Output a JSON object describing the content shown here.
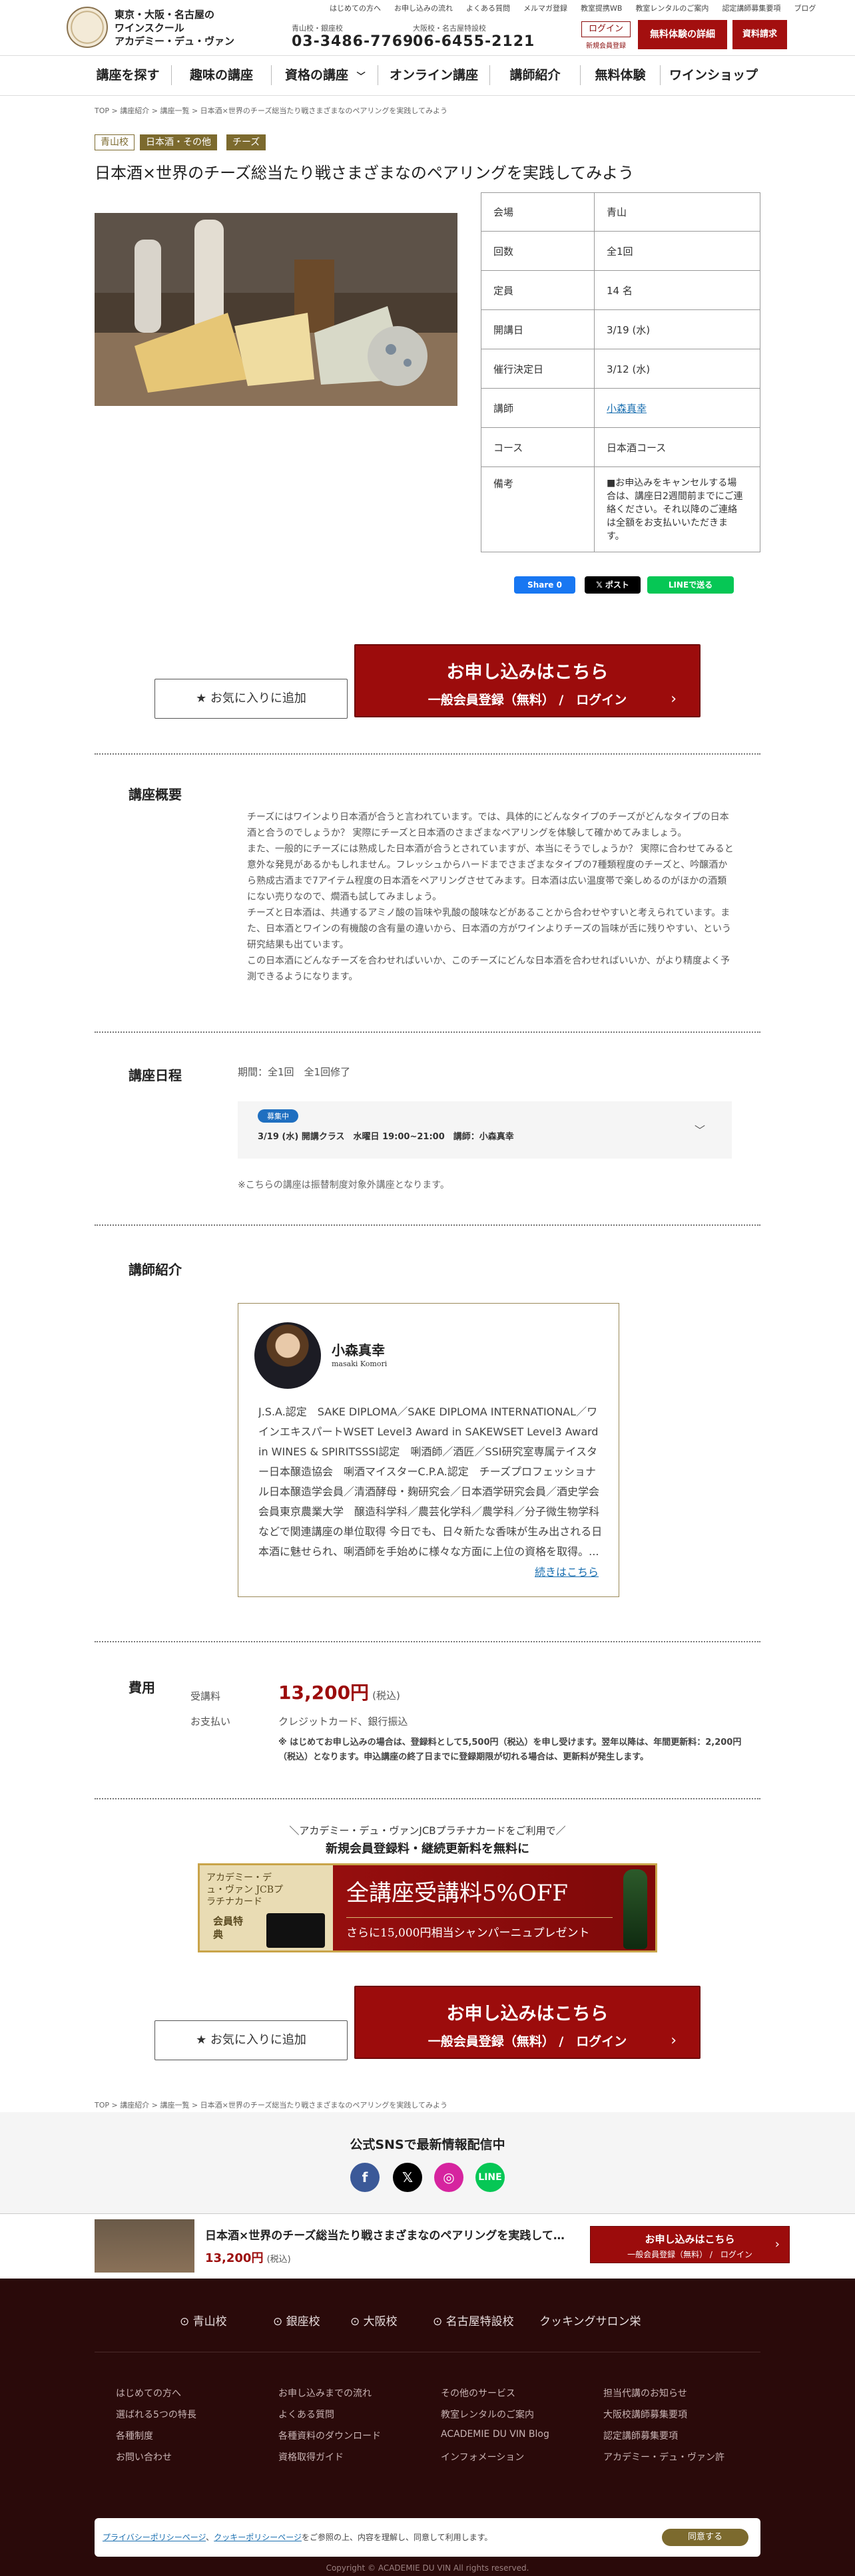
{
  "header": {
    "logo_text": [
      "東京・大阪・名古屋の",
      "ワインスクール",
      "アカデミー・デュ・ヴァン"
    ],
    "top_links": [
      "はじめての方へ",
      "お申し込みの流れ",
      "よくある質問",
      "メルマガ登録",
      "教室提携WB",
      "教室レンタルのご案内",
      "認定講師募集要項",
      "ブログ"
    ],
    "phone_tokyo_label": "青山校・銀座校",
    "phone_tokyo": "03-3486-7769",
    "phone_osaka_label": "大阪校・名古屋特設校",
    "phone_osaka": "06-6455-2121",
    "login": "ログイン",
    "new_register": "新規会員登録",
    "trial_button": "無料体験の詳細",
    "doc_button": "資料請求"
  },
  "nav": [
    "講座を探す",
    "趣味の講座",
    "資格の講座",
    "オンライン講座",
    "講師紹介",
    "無料体験",
    "ワインショップ"
  ],
  "breadcrumb": [
    "TOP",
    "講座紹介",
    "講座一覧",
    "日本酒×世界のチーズ総当たり戦さまざまなのペアリングを実践してみよう"
  ],
  "tags": [
    "青山校",
    "日本酒・その他",
    "チーズ"
  ],
  "course": {
    "title": "日本酒×世界のチーズ総当たり戦さまざまなのペアリングを実践してみよう"
  },
  "info": [
    {
      "label": "会場",
      "value": "青山"
    },
    {
      "label": "回数",
      "value": "全1回"
    },
    {
      "label": "定員",
      "value": "14 名"
    },
    {
      "label": "開講日",
      "value": "3/19 (水)"
    },
    {
      "label": "催行決定日",
      "value": "3/12 (水)"
    },
    {
      "label": "講師",
      "value": "小森真幸"
    },
    {
      "label": "コース",
      "value": "日本酒コース"
    },
    {
      "label": "備考",
      "value": "■お申込みをキャンセルする場合は、講座日2週間前までにご連絡ください。それ以降のご連絡は全額をお支払いいただきます。"
    }
  ],
  "share": {
    "facebook": "Share 0",
    "x": "ポスト",
    "line": "LINEで送る"
  },
  "cta": {
    "favorite": "★ お気に入りに追加",
    "apply_line1": "お申し込みはこちら",
    "apply_line2": "一般会員登録（無料） /　ログイン",
    "arrow": "›"
  },
  "overview": {
    "title": "講座概要",
    "paragraphs": [
      "チーズにはワインより日本酒が合うと言われています。では、具体的にどんなタイプのチーズがどんなタイプの日本酒と合うのでしょうか？ 実際にチーズと日本酒のさまざまなペアリングを体験して確かめてみましょう。",
      "また、一般的にチーズには熟成した日本酒が合うとされていますが、本当にそうでしょうか？ 実際に合わせてみると意外な発見があるかもしれません。フレッシュからハードまでさまざまなタイプの7種類程度のチーズと、吟醸酒から熟成古酒まで7アイテム程度の日本酒をペアリングさせてみます。日本酒は広い温度帯で楽しめるのがほかの酒類にない売りなので、燗酒も試してみましょう。",
      "チーズと日本酒は、共通するアミノ酸の旨味や乳酸の酸味などがあることから合わせやすいと考えられています。また、日本酒とワインの有機酸の含有量の違いから、日本酒の方がワインよりチーズの旨味が舌に残りやすい、という研究結果も出ています。",
      "この日本酒にどんなチーズを合わせればいいか、このチーズにどんな日本酒を合わせればいいか、がより精度よく予測できるようになります。"
    ]
  },
  "schedule": {
    "title": "講座日程",
    "period": "期間：全1回　全1回修了",
    "badge": "募集中",
    "class_line": "3/19 (水) 開講クラス　水曜日 19:00~21:00　講師：小森真幸",
    "note": "※こちらの講座は振替制度対象外講座となります。"
  },
  "instructor": {
    "section_title": "講師紹介",
    "name": "小森真幸",
    "name_en": "masaki Komori",
    "bio": "J.S.A.認定　SAKE DIPLOMA／SAKE DIPLOMA INTERNATIONAL／ワインエキスパートWSET Level3 Award in SAKEWSET Level3 Award in WINES & SPIRITSSSI認定　唎酒師／酒匠／SSI研究室専属テイスター日本醸造協会　唎酒マイスターC.P.A.認定　チーズプロフェッショナル日本醸造学会員／清酒酵母・麹研究会／日本酒学研究会員／酒史学会会員東京農業大学　醸造科学科／農芸化学科／農学科／分子微生物学科などで関連講座の単位取得 今日でも、日々新たな香味が生み出される日本酒に魅せられ、唎酒師を手始めに様々な方面に上位の資格を取得。...",
    "more": "続きはこちら"
  },
  "fees": {
    "title": "費用",
    "fee_label": "受講料",
    "fee_value": "13,200円",
    "fee_tax": "(税込)",
    "pay_label": "お支払い",
    "pay_value": "クレジットカード、銀行振込",
    "note": "※ はじめてお申し込みの場合は、登録料として5,500円（税込）を申し受けます。翌年以降は、年間更新料：2,200円（税込）となります。申込講座の終了日までに登録期限が切れる場合は、更新料が発生します。"
  },
  "promo": {
    "line1": "＼アカデミー・デュ・ヴァンJCBプラチナカードをご利用で／",
    "line2": "新規会員登録料・継続更新料を無料に",
    "card_name": "アカデミー・デュ・ヴァン JCBプラチナカード",
    "member": "会員特典",
    "headline": "全講座受講料5%OFF",
    "sub": "さらに15,000円相当シャンパーニュプレゼント"
  },
  "sns": {
    "title": "公式SNSで最新情報配信中",
    "icons": [
      "facebook-icon",
      "x-icon",
      "instagram-icon",
      "line-icon"
    ]
  },
  "sticky": {
    "title": "日本酒×世界のチーズ総当たり戦さまざまなのペアリングを実践して…",
    "price": "13,200円",
    "tax": "(税込)",
    "apply1": "お申し込みはこちら",
    "apply2": "一般会員登録（無料） /　ログイン"
  },
  "footer": {
    "schools": [
      "青山校",
      "銀座校",
      "大阪校",
      "名古屋特設校",
      "クッキングサロン栄"
    ],
    "col1": [
      "はじめての方へ",
      "選ばれる5つの特長",
      "各種制度",
      "お問い合わせ"
    ],
    "col2": [
      "お申し込みまでの流れ",
      "よくある質問",
      "各種資料のダウンロード",
      "資格取得ガイド"
    ],
    "col3": [
      "その他のサービス",
      "教室レンタルのご案内",
      "ACADEMIE DU VIN Blog",
      "インフォメーション"
    ],
    "col4": [
      "担当代講のお知らせ",
      "大阪校講師募集要項",
      "認定講師募集要項",
      "アカデミー・デュ・ヴァン許"
    ],
    "copyright": "Copyright © ACADEMIE DU VIN All rights reserved."
  },
  "cookie": {
    "privacy": "プライバシーポリシーページ",
    "sep": "、",
    "cookie_policy": "クッキーポリシーページ",
    "text": "をご参照の上、内容を理解し、同意して利用します。",
    "agree": "同意する"
  },
  "colors": {
    "brand_red": "#a30f0f",
    "gold": "#9b8a5a",
    "link": "#1a6fb0",
    "footer_bg": "#2a0a0a"
  }
}
